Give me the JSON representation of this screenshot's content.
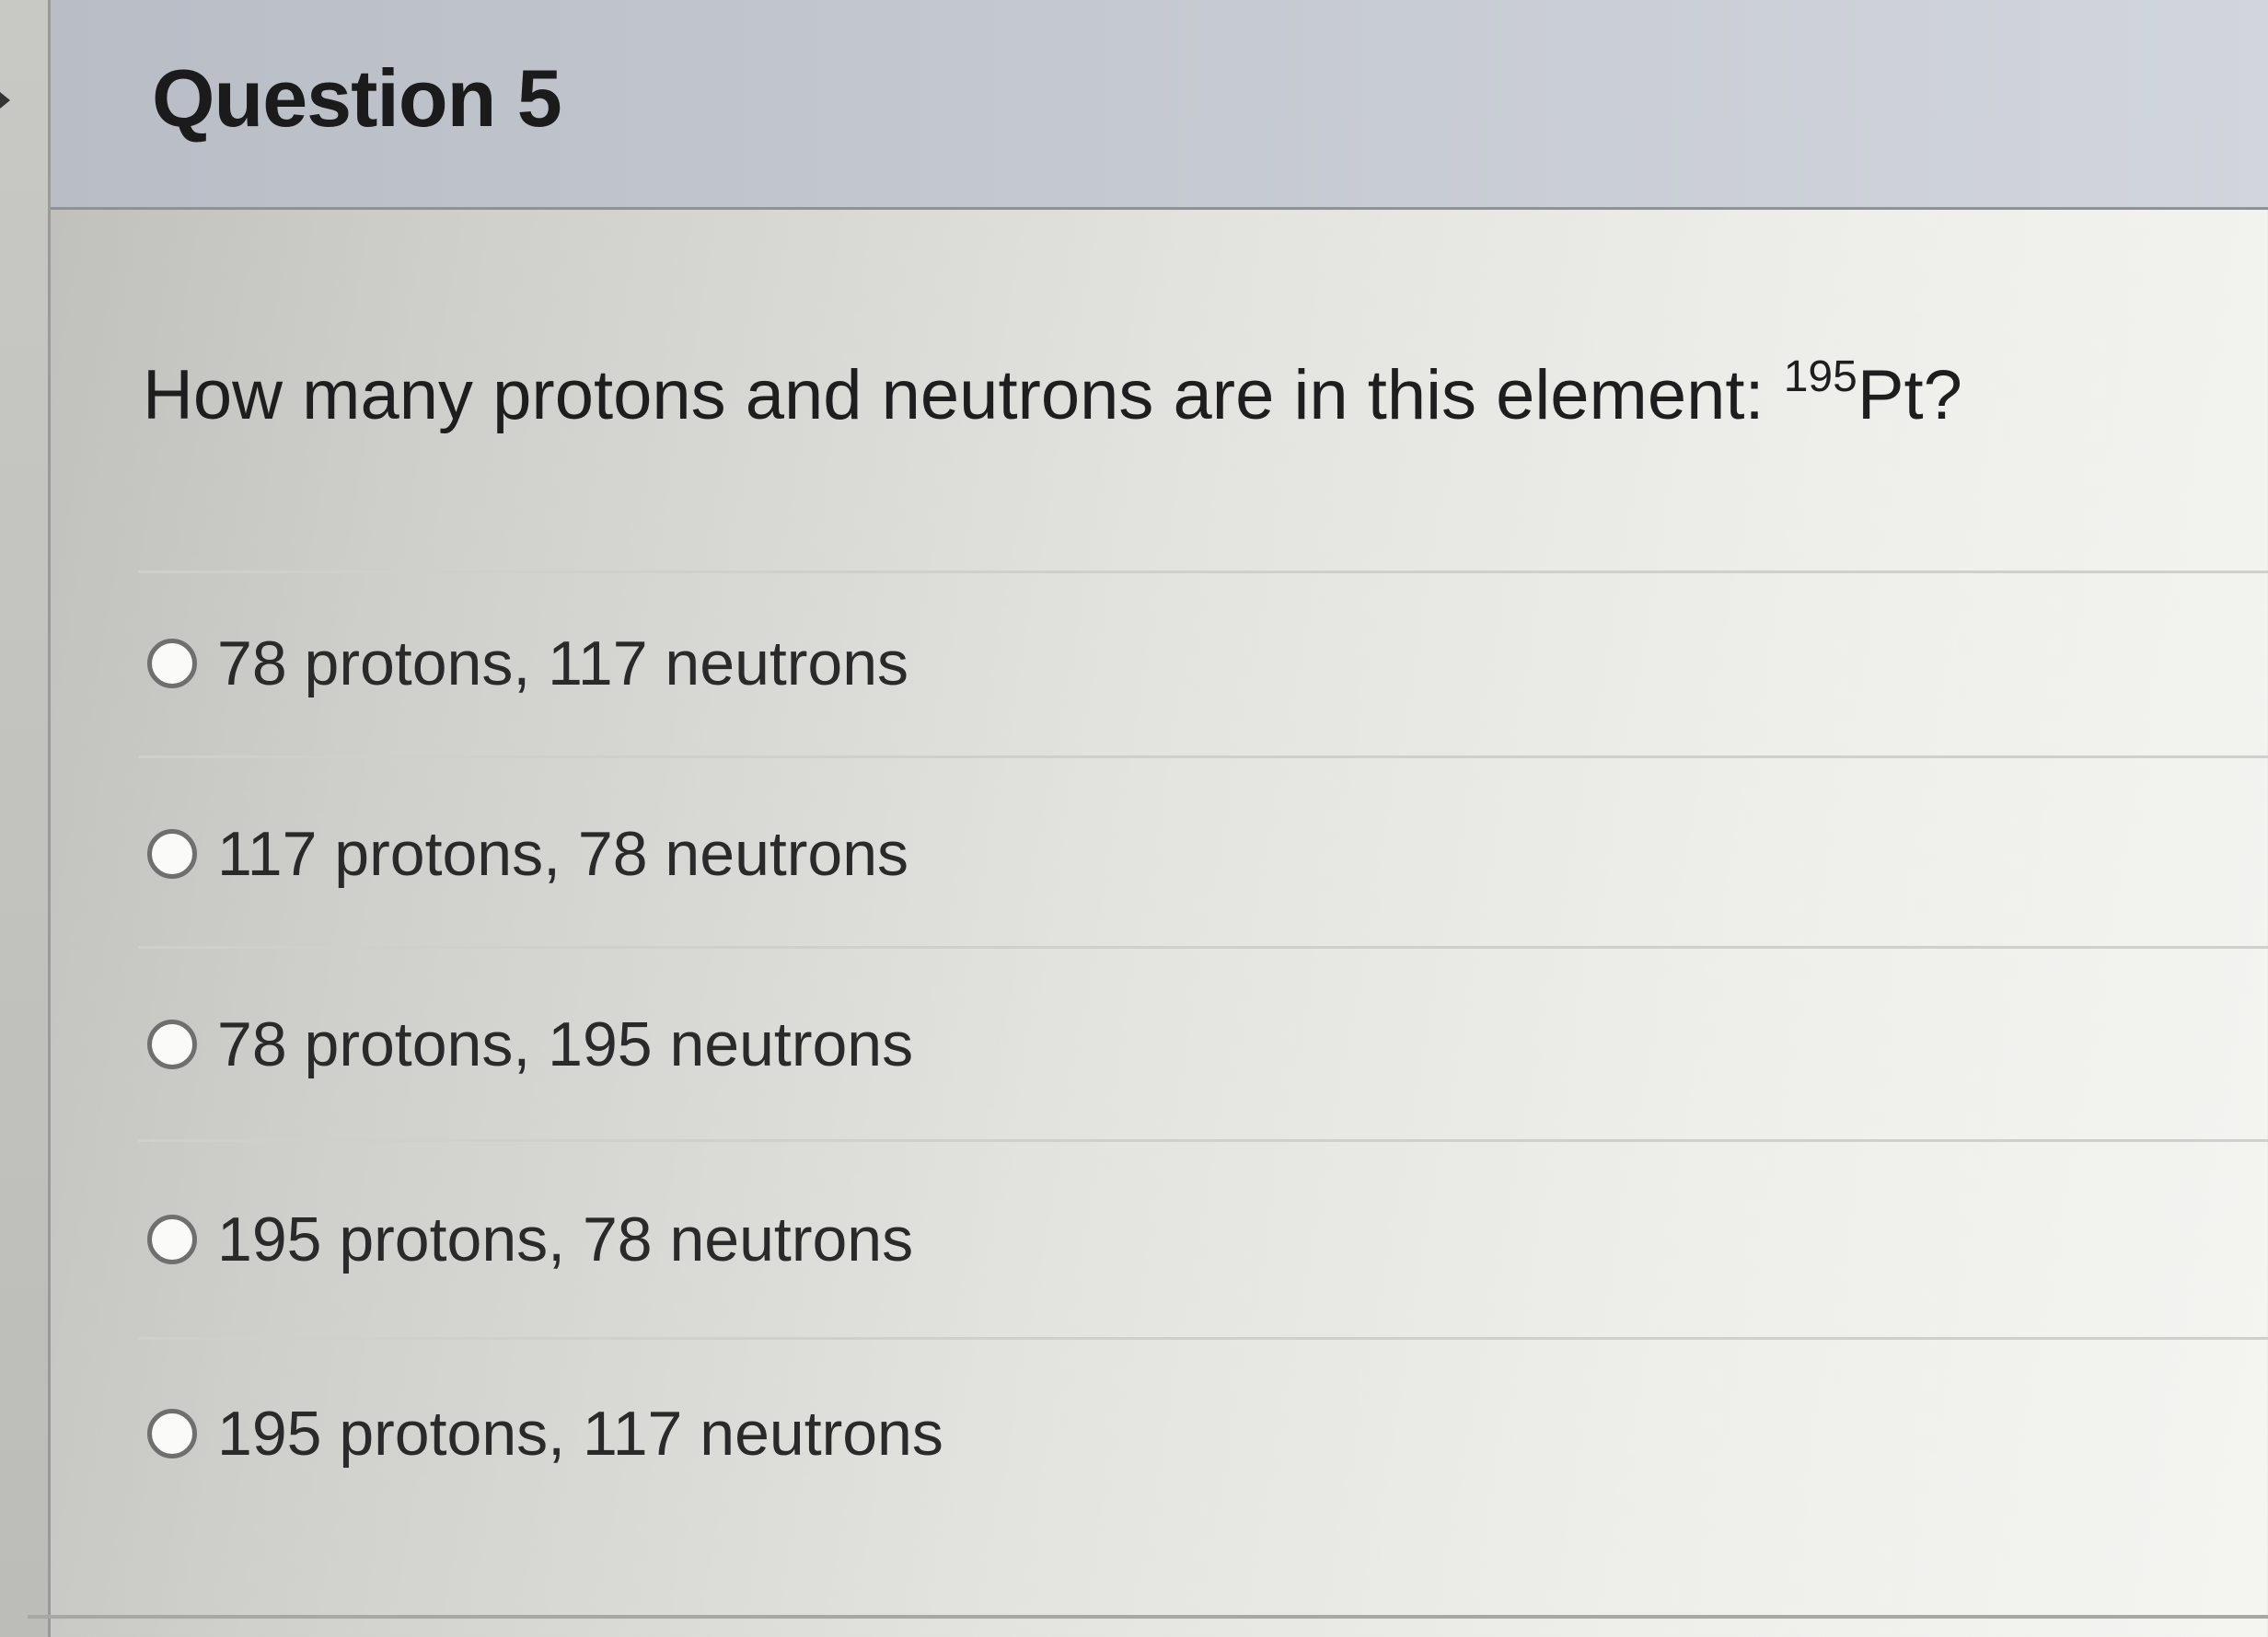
{
  "question": {
    "title": "Question 5",
    "text_prefix": "How many protons and neutrons are in this element: ",
    "superscript": "195",
    "element": "Pt?"
  },
  "answers": [
    {
      "label": "78 protons, 117 neutrons"
    },
    {
      "label": "117 protons, 78 neutrons"
    },
    {
      "label": "78 protons, 195 neutrons"
    },
    {
      "label": "195 protons, 78 neutrons"
    },
    {
      "label": "195 protons, 117 neutrons"
    }
  ],
  "colors": {
    "header_bg": "#c4c8d0",
    "text": "#1e1e1e",
    "radio_border": "#6f6f6f"
  },
  "icons": {
    "collapse": "caret-right-icon",
    "radio": "radio-unselected-icon"
  }
}
